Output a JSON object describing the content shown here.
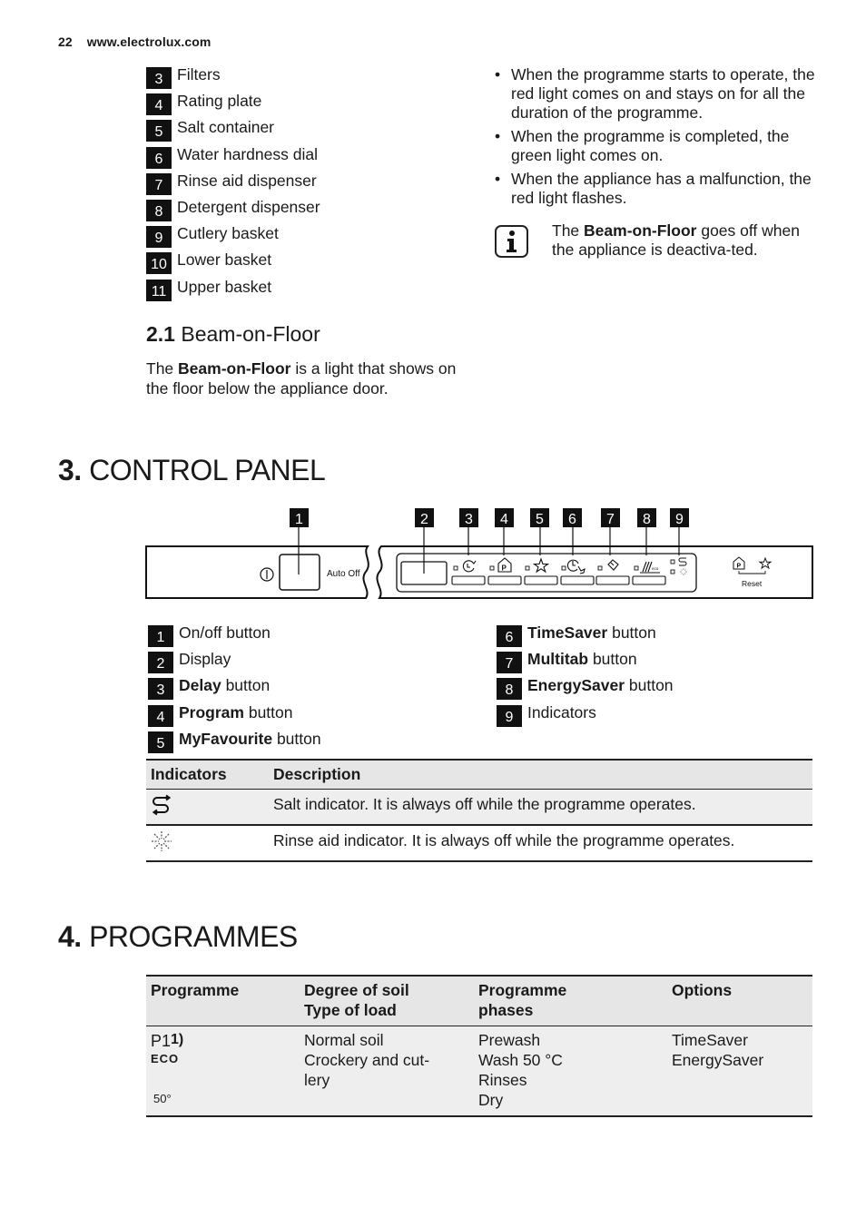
{
  "header": {
    "page_number": "22",
    "website": "www.electrolux.com"
  },
  "parts_list": [
    {
      "num": "3",
      "label": "Filters"
    },
    {
      "num": "4",
      "label": "Rating plate"
    },
    {
      "num": "5",
      "label": "Salt container"
    },
    {
      "num": "6",
      "label": "Water hardness dial"
    },
    {
      "num": "7",
      "label": "Rinse aid dispenser"
    },
    {
      "num": "8",
      "label": "Detergent dispenser"
    },
    {
      "num": "9",
      "label": "Cutlery basket"
    },
    {
      "num": "10",
      "label": "Lower basket"
    },
    {
      "num": "11",
      "label": "Upper basket"
    }
  ],
  "beam_section": {
    "number": "2.1",
    "title": "Beam-on-Floor",
    "para_pre": "The ",
    "para_bold": "Beam-on-Floor",
    "para_post": " is a light that shows on the floor below the appliance door."
  },
  "bullets": [
    "When the programme starts to operate, the red light comes on and stays on for all the duration of the programme.",
    "When the programme is completed, the green light comes on.",
    "When the appliance has a malfunction, the red light flashes."
  ],
  "note": {
    "icon": "info-icon",
    "pre": "The ",
    "bold": "Beam-on-Floor",
    "post": " goes off when the appliance is deactiva-ted."
  },
  "section3": {
    "number": "3.",
    "title": "CONTROL PANEL"
  },
  "panel": {
    "callouts": [
      "1",
      "2",
      "3",
      "4",
      "5",
      "6",
      "7",
      "8",
      "9"
    ],
    "auto_off_label": "Auto Off",
    "reset_label": "Reset"
  },
  "controls_left": [
    {
      "num": "1",
      "bold": "",
      "label": "On/off button"
    },
    {
      "num": "2",
      "bold": "",
      "label": "Display"
    },
    {
      "num": "3",
      "bold": "Delay",
      "label": " button"
    },
    {
      "num": "4",
      "bold": "Program",
      "label": " button"
    },
    {
      "num": "5",
      "bold": "MyFavourite",
      "label": " button"
    }
  ],
  "controls_right": [
    {
      "num": "6",
      "bold": "TimeSaver",
      "label": " button"
    },
    {
      "num": "7",
      "bold": "Multitab",
      "label": " button"
    },
    {
      "num": "8",
      "bold": "EnergySaver",
      "label": " button"
    },
    {
      "num": "9",
      "bold": "",
      "label": "Indicators"
    }
  ],
  "indicators_table": {
    "headers": [
      "Indicators",
      "Description"
    ],
    "rows": [
      {
        "icon": "salt-indicator-icon",
        "description": "Salt indicator. It is always off while the programme operates."
      },
      {
        "icon": "rinse-aid-indicator-icon",
        "description": "Rinse aid indicator. It is always off while the programme operates."
      }
    ]
  },
  "section4": {
    "number": "4.",
    "title": "PROGRAMMES"
  },
  "programmes_table": {
    "headers": [
      "Programme",
      "Degree of soil Type of load",
      "Programme phases",
      "Options"
    ],
    "header_lines": [
      [
        "Programme"
      ],
      [
        "Degree of soil",
        "Type of load"
      ],
      [
        "Programme",
        "phases"
      ],
      [
        "Options"
      ]
    ],
    "rows": [
      {
        "programme": "P1",
        "footnote": "1)",
        "eco_label": "ECO",
        "temp_label": "50°",
        "soil": [
          "Normal soil",
          "Crockery and cut-",
          "lery"
        ],
        "phases": [
          "Prewash",
          "Wash 50 °C",
          "Rinses",
          "Dry"
        ],
        "options": [
          "TimeSaver",
          "EnergySaver"
        ]
      }
    ]
  }
}
